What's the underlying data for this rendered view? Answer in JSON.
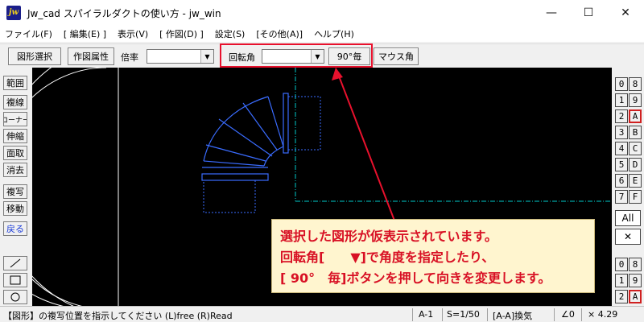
{
  "window": {
    "title": "Jw_cad スパイラルダクトの使い方 - jw_win",
    "app_icon_text": "jw",
    "minimize_glyph": "—",
    "maximize_glyph": "☐",
    "close_glyph": "✕"
  },
  "menu": {
    "items": [
      "ファイル(F)",
      "[ 編集(E) ]",
      "表示(V)",
      "[ 作図(D) ]",
      "設定(S)",
      "[その他(A)]",
      "ヘルプ(H)"
    ]
  },
  "toolbar": {
    "select_label": "図形選択",
    "attr_label": "作図属性",
    "scale_label": "倍率",
    "scale_value": "",
    "rotate_label": "回転角",
    "rotate_value": "",
    "ninety_label": "90°毎",
    "mouse_angle_label": "マウス角"
  },
  "left_tools": [
    "範囲",
    "複線",
    "コーナー",
    "伸縮",
    "面取",
    "消去",
    "複写",
    "移動",
    "戻る"
  ],
  "right_layers": {
    "left_col": [
      "0",
      "1",
      "2",
      "3",
      "4",
      "5",
      "6",
      "7"
    ],
    "right_col": [
      "8",
      "9",
      "A",
      "B",
      "C",
      "D",
      "E",
      "F"
    ],
    "all_label": "All",
    "x_label": "✕",
    "group_left": [
      "0",
      "1",
      "2"
    ],
    "group_right": [
      "8",
      "9",
      "A"
    ]
  },
  "callout": {
    "line1": "選択した図形が仮表示されています。",
    "line2": "回転角[　　▼]で角度を指定したり、",
    "line3": "[ 90°　毎]ボタンを押して向きを変更します。"
  },
  "status": {
    "message": "【図形】の複写位置を指示してください (L)free (R)Read",
    "layer": "A-1",
    "scale": "S=1/50",
    "mode": "[A-A]換気",
    "angle": "∠0",
    "ratio": "× 4.29"
  },
  "colors": {
    "canvas_bg": "#000000",
    "duct_blue": "#3a6cff",
    "guide_cyan": "#00c8c8",
    "highlight_red": "#e8112d",
    "callout_bg": "#fff5cf",
    "callout_text": "#d81024"
  }
}
